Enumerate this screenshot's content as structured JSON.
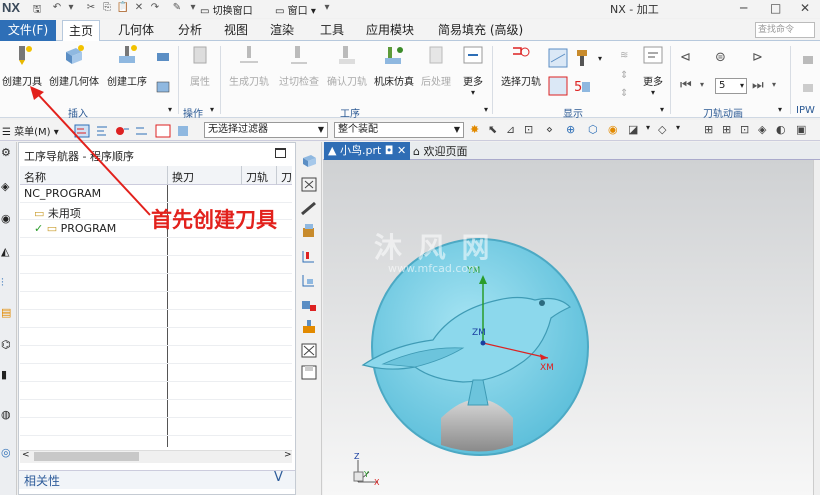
{
  "titlebar": {
    "logo": "NX",
    "switch_window": "切换窗口",
    "window_menu": "窗口",
    "app_title": "NX - 加工",
    "min": "─",
    "max": "□",
    "close": "✕"
  },
  "tabs": {
    "file": "文件(F)",
    "items": [
      "主页",
      "几何体",
      "分析",
      "视图",
      "渲染",
      "工具",
      "应用模块",
      "简易填充 (高级)"
    ],
    "active": "主页",
    "search_placeholder": "查找命令"
  },
  "ribbon": {
    "buttons": [
      {
        "label": "创建刀具"
      },
      {
        "label": "创建几何体"
      },
      {
        "label": "创建工序"
      },
      {
        "label": "属性"
      },
      {
        "label": "生成刀轨"
      },
      {
        "label": "过切检查"
      },
      {
        "label": "确认刀轨"
      },
      {
        "label": "机床仿真"
      },
      {
        "label": "后处理"
      },
      {
        "label": "更多"
      },
      {
        "label": "选择刀轨"
      },
      {
        "label": "更多"
      }
    ],
    "groups": [
      "插入",
      "操作",
      "工序",
      "显示",
      "刀轨动画",
      "IPW"
    ],
    "anim_speed": "5"
  },
  "toolbar2": {
    "menu": "菜单(M)",
    "filter": "无选择过滤器",
    "assembly": "整个装配"
  },
  "navigator": {
    "title": "工序导航器 - 程序顺序",
    "columns": [
      "名称",
      "换刀",
      "刀轨",
      "刀"
    ],
    "rows": [
      {
        "name": "NC_PROGRAM"
      },
      {
        "name": "未用项"
      },
      {
        "name": "PROGRAM"
      }
    ],
    "relevance": "相关性",
    "rel_arrow": "V"
  },
  "graphics": {
    "tab_file": "小鸟.prt",
    "tab_file_markers": "◘ ✕",
    "tab_welcome": "欢迎页面",
    "axis_x": "XM",
    "axis_y": "YM",
    "axis_z": "ZM",
    "triad_x": "X",
    "triad_y": "Y",
    "triad_z": "Z",
    "watermark": "沐 风 网",
    "watermark_url": "www.mfcad.com"
  },
  "annotation": "首先创建刀具",
  "colors": {
    "accent": "#2e6fb7",
    "annotation": "#e2211c",
    "model": "#7fd3ea"
  }
}
